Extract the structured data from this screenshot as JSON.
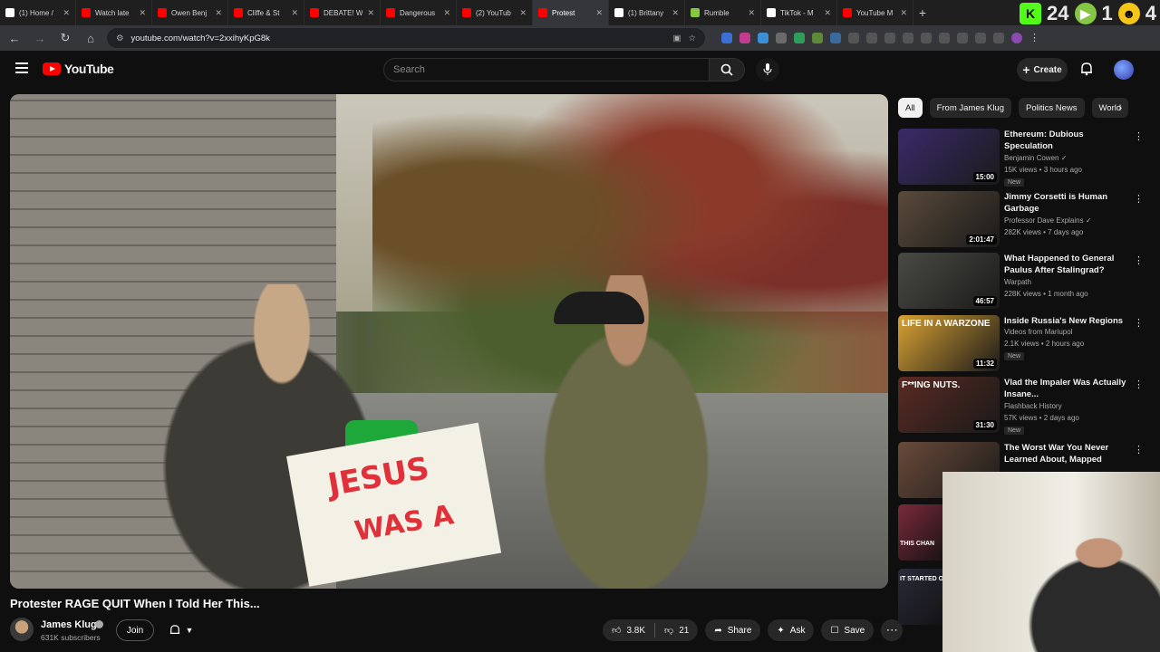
{
  "browser": {
    "tabs": [
      {
        "title": "(1) Home /",
        "color": "#ffffff"
      },
      {
        "title": "Watch late",
        "color": "#ff0000"
      },
      {
        "title": "Owen Benj",
        "color": "#ff0000"
      },
      {
        "title": "Cliffe & St",
        "color": "#ff0000"
      },
      {
        "title": "DEBATE! W",
        "color": "#ff0000"
      },
      {
        "title": "Dangerous",
        "color": "#ff0000"
      },
      {
        "title": "(2) YouTub",
        "color": "#ff0000"
      },
      {
        "title": "Protest",
        "color": "#ff0000",
        "active": true
      },
      {
        "title": "(1) Brittany",
        "color": "#ffffff"
      },
      {
        "title": "Rumble",
        "color": "#85c742"
      },
      {
        "title": "TikTok - M",
        "color": "#ffffff"
      },
      {
        "title": "YouTube M",
        "color": "#ff0000"
      }
    ],
    "new_tab": "+",
    "overlay_numbers": [
      "24",
      "1",
      "4"
    ],
    "url": "youtube.com/watch?v=2xxihyKpG8k"
  },
  "header": {
    "logo_text": "YouTube",
    "search_placeholder": "Search",
    "create_label": "Create"
  },
  "video": {
    "title": "Protester RAGE QUIT When I Told Her This...",
    "sign_line1": "JESUS",
    "sign_line2": "WAS A",
    "channel_name": "James Klug",
    "subscribers": "631K subscribers",
    "join_label": "Join",
    "likes": "3.8K",
    "dislikes": "21",
    "share_label": "Share",
    "ask_label": "Ask",
    "save_label": "Save"
  },
  "chips": [
    "All",
    "From James Klug",
    "Politics News",
    "World"
  ],
  "recommendations": [
    {
      "title": "Ethereum: Dubious Speculation",
      "channel": "Benjamin Cowen",
      "verified": true,
      "meta": "15K views • 3 hours ago",
      "new": "New",
      "duration": "15:00",
      "thumb": "#3a2a6a"
    },
    {
      "title": "Jimmy Corsetti is Human Garbage",
      "channel": "Professor Dave Explains",
      "verified": true,
      "meta": "282K views • 7 days ago",
      "new": "",
      "duration": "2:01:47",
      "thumb": "#5a4a3a"
    },
    {
      "title": "What Happened to General Paulus After Stalingrad?",
      "channel": "Warpath",
      "verified": false,
      "meta": "228K views • 1 month ago",
      "new": "",
      "duration": "46:57",
      "thumb": "#4a4a44"
    },
    {
      "title": "Inside Russia's New Regions",
      "channel": "Videos from Mariupol",
      "verified": false,
      "meta": "2.1K views • 2 hours ago",
      "new": "New",
      "duration": "11:32",
      "thumb": "#d9a233",
      "thumb_text": "LIFE IN A WARZONE"
    },
    {
      "title": "Vlad the Impaler Was Actually Insane...",
      "channel": "Flashback History",
      "verified": false,
      "meta": "57K views • 2 days ago",
      "new": "New",
      "duration": "31:30",
      "thumb": "#5a2a22",
      "thumb_text": "F**ING NUTS."
    },
    {
      "title": "The Worst War You Never Learned About, Mapped",
      "channel": "",
      "verified": false,
      "meta": "",
      "new": "",
      "duration": "",
      "thumb": "#6a4a3a"
    }
  ],
  "partial_thumbs": [
    {
      "text": "THIS CHAN",
      "color": "#7a2a3a"
    },
    {
      "text": "IT STARTED ON",
      "color": "#2a2a3a"
    }
  ]
}
